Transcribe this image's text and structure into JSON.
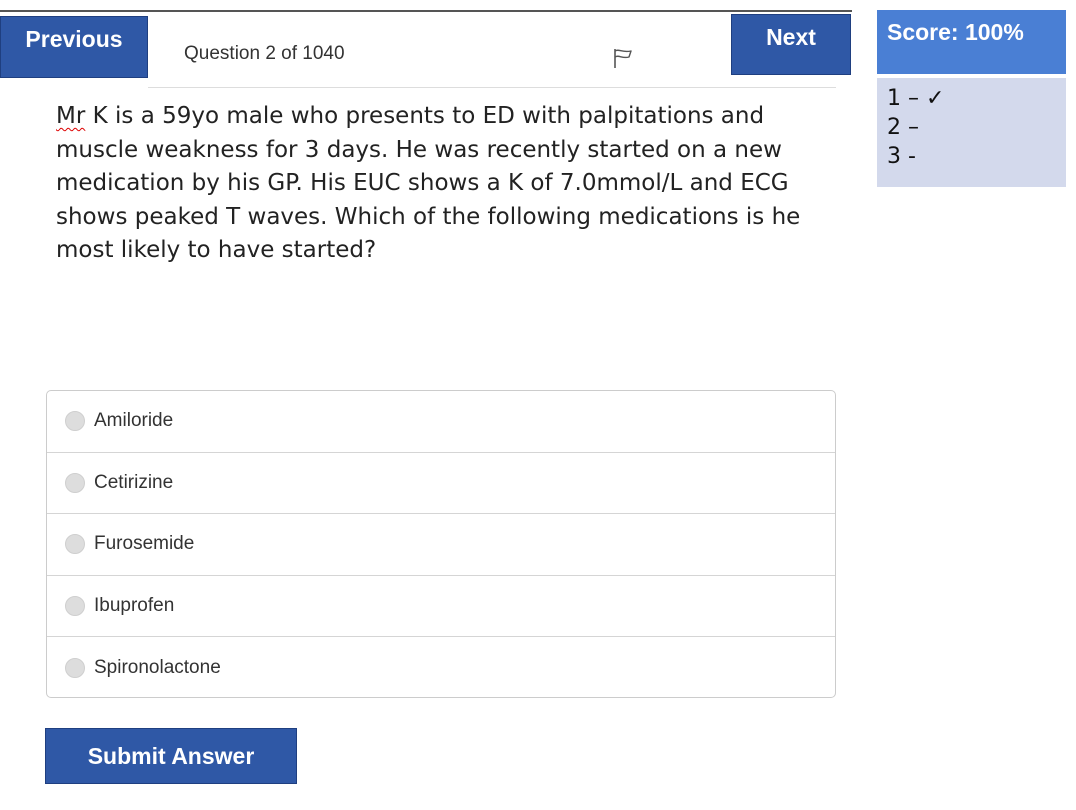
{
  "nav": {
    "previous_label": "Previous",
    "next_label": "Next",
    "question_counter": "Question 2 of 1040"
  },
  "question": {
    "name_word": "Mr",
    "text_rest": " K is a 59yo male who presents to ED with palpitations and muscle weakness for 3 days. He was recently started on a new medication by his GP. His EUC shows a K of 7.0mmol/L and ECG shows peaked T waves. Which of the following medications is he most likely to have started?",
    "options": [
      "Amiloride",
      "Cetirizine",
      "Furosemide",
      "Ibuprofen",
      "Spironolactone"
    ]
  },
  "submit_label": "Submit Answer",
  "score": {
    "label": "Score: 100%",
    "history": [
      "1 – ✓",
      "2 –",
      "3 -"
    ]
  },
  "icons": {
    "flag": "flag-icon",
    "radio": "radio-circle-icon"
  },
  "colors": {
    "button_blue": "#2f58a6",
    "score_blue": "#4a7fd4",
    "history_bg": "#d3d9ec"
  }
}
